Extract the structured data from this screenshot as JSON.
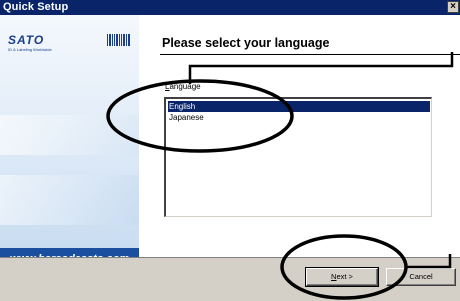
{
  "window": {
    "title": "Quick Setup",
    "close_glyph": "×"
  },
  "sidebar": {
    "logo": "SATO",
    "tagline": "ID & Labeling Worldwide",
    "url": "www.barcodesato.com"
  },
  "main": {
    "heading": "Please select your language",
    "field_label_prefix": "",
    "field_label_accel": "L",
    "field_label_rest": "anguage",
    "languages": [
      "English",
      "Japanese"
    ],
    "selected_index": 0
  },
  "buttons": {
    "next_accel": "N",
    "next_rest": "ext >",
    "cancel_label": "Cancel"
  },
  "colors": {
    "titlebar": "#0a246a",
    "selection": "#0a246a",
    "url_band": "#1a4fa0",
    "dialog_face": "#d4d0c8"
  }
}
